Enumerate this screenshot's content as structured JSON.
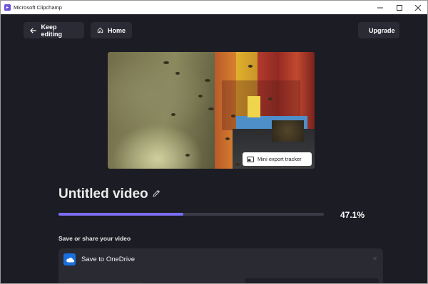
{
  "window": {
    "title": "Microsoft Clipchamp"
  },
  "toolbar": {
    "keep_editing_label": "Keep editing",
    "home_label": "Home",
    "upgrade_label": "Upgrade"
  },
  "preview": {
    "mini_tracker_label": "Mini export tracker"
  },
  "project": {
    "title": "Untitled video"
  },
  "export": {
    "progress": 0.471,
    "progress_text": "47.1%"
  },
  "share": {
    "section_label": "Save or share your video",
    "onedrive_label": "Save to OneDrive"
  },
  "colors": {
    "accent": "#7a6ef0",
    "background": "#1c1c24",
    "card": "#2a2a33",
    "onedrive": "#1a6fdf",
    "upgrade_icon": "#f3b94a"
  }
}
